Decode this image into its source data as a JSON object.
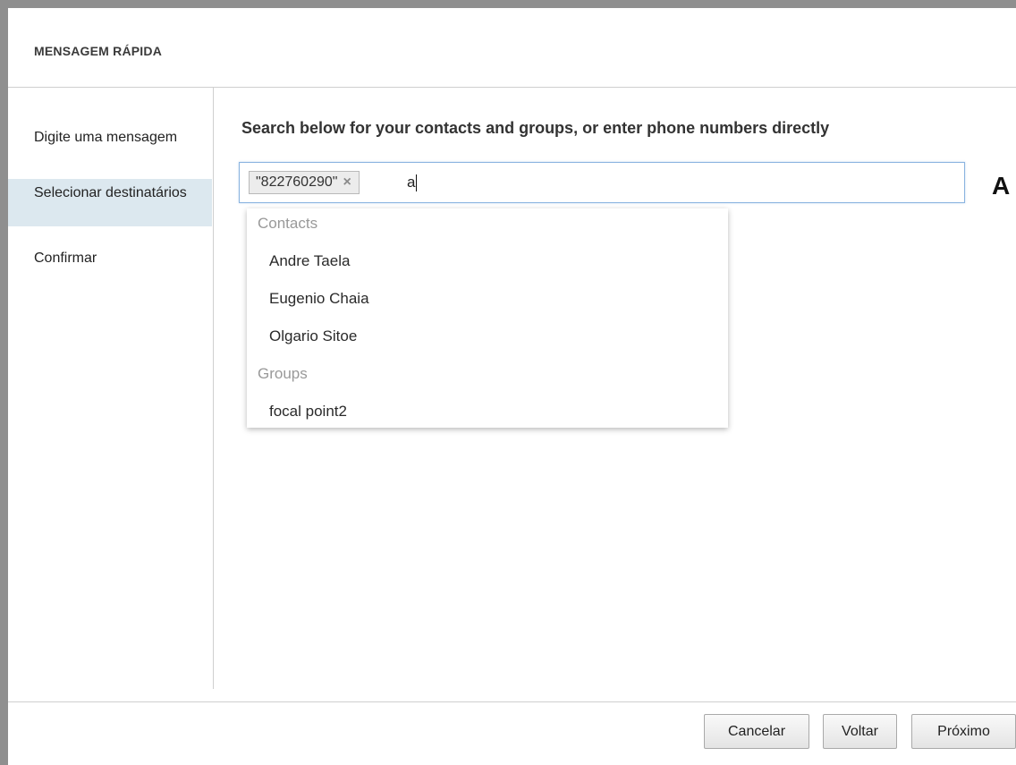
{
  "header": {
    "title": "MENSAGEM RÁPIDA"
  },
  "sidebar": {
    "items": [
      {
        "label": "Digite uma mensagem",
        "active": false
      },
      {
        "label": "Selecionar destinatários",
        "active": true
      },
      {
        "label": "Confirmar",
        "active": false
      }
    ]
  },
  "main": {
    "instruction": "Search below for your contacts and groups, or enter phone numbers directly",
    "search": {
      "chip": "\"822760290\"",
      "chip_remove_icon": "close-icon",
      "typed_value": "a"
    },
    "side_letter": "A",
    "dropdown": {
      "contacts_header": "Contacts",
      "contacts": [
        "Andre Taela",
        "Eugenio Chaia",
        "Olgario Sitoe"
      ],
      "groups_header": "Groups",
      "groups": [
        "focal point2"
      ]
    }
  },
  "footer": {
    "cancel_label": "Cancelar",
    "back_label": "Voltar",
    "next_label": "Próximo"
  },
  "colors": {
    "active_step_bg": "#dce8ef",
    "search_focus_border": "#8ab4e0",
    "group_header_text": "#999999",
    "window_frame": "#8f8f8f"
  }
}
